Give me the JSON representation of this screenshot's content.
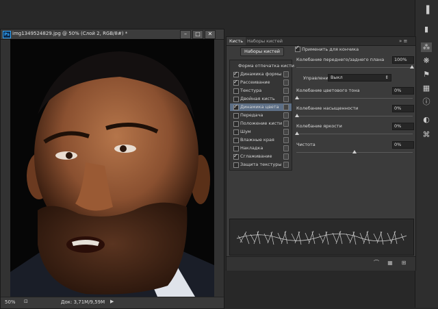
{
  "document": {
    "title": "img1349524829.jpg @ 50% (Слой 2, RGB/8#) *",
    "app_badge": "Ps",
    "zoom": "50%",
    "doc_size": "Док: 3,71M/9,59M",
    "window_buttons": {
      "minimize": "–",
      "maximize": "□",
      "close": "✕"
    }
  },
  "panel": {
    "tabs": [
      {
        "label": "Кисть"
      },
      {
        "label": "Наборы кистей"
      }
    ],
    "menu_glyph": "»  ≡",
    "presets_button": "Наборы кистей",
    "left_list": [
      {
        "label": "Форма отпечатка кисти",
        "checked": false,
        "header": true,
        "lock": false
      },
      {
        "label": "Динамика формы",
        "checked": true,
        "lock": true
      },
      {
        "label": "Рассеивание",
        "checked": true,
        "lock": true
      },
      {
        "label": "Текстура",
        "checked": false,
        "lock": true
      },
      {
        "label": "Двойная кисть",
        "checked": false,
        "lock": true
      },
      {
        "label": "Динамика цвета",
        "checked": true,
        "lock": true,
        "selected": true
      },
      {
        "label": "Передача",
        "checked": false,
        "lock": true
      },
      {
        "label": "Положение кисти",
        "checked": false,
        "lock": true
      },
      {
        "label": "Шум",
        "checked": false,
        "lock": true
      },
      {
        "label": "Влажные края",
        "checked": false,
        "lock": true
      },
      {
        "label": "Накладка",
        "checked": false,
        "lock": true
      },
      {
        "label": "Сглаживание",
        "checked": true,
        "lock": true
      },
      {
        "label": "Защита текстуры",
        "checked": false,
        "lock": true
      }
    ],
    "apply_per_tip": {
      "label": "Применить для кончика",
      "checked": true
    },
    "fg_bg_jitter": {
      "label": "Колебание переднего/заднего плана",
      "value": "100%"
    },
    "control": {
      "label": "Управление:",
      "value": "Выкл"
    },
    "hue_jitter": {
      "label": "Колебание цветового тона",
      "value": "0%"
    },
    "saturation_jitter": {
      "label": "Колебание насыщенности",
      "value": "0%"
    },
    "brightness_jitter": {
      "label": "Колебание яркости",
      "value": "0%"
    },
    "purity": {
      "label": "Чистота",
      "value": "0%"
    }
  }
}
